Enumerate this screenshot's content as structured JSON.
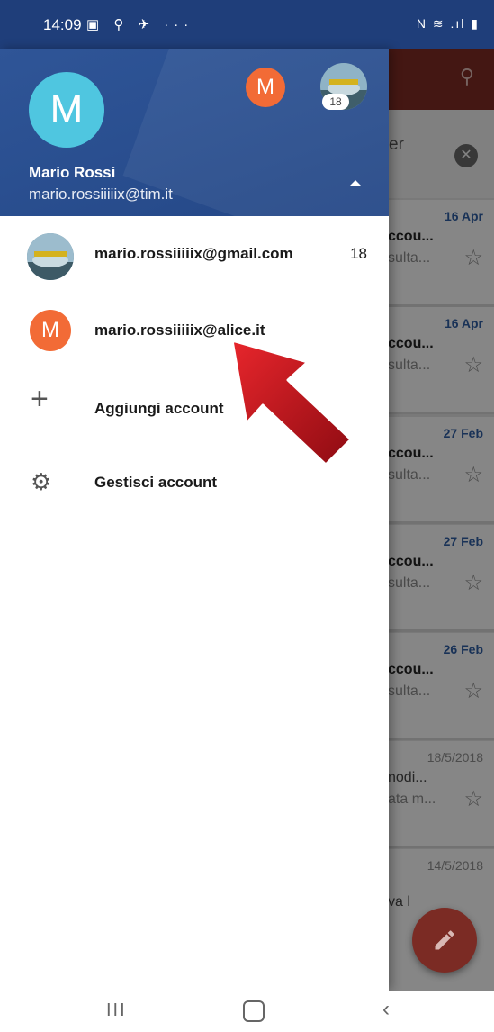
{
  "status_bar": {
    "time": "14:09",
    "left_icons": "▣ ⚲ ✈ ···",
    "right_icons": "N ≋ .ıl ▮"
  },
  "background_list": {
    "filter_text": "er",
    "rows": [
      {
        "date": "16 Apr",
        "subject": "ccou...",
        "preview": "sulta...",
        "unread": true
      },
      {
        "date": "16 Apr",
        "subject": "ccou...",
        "preview": "sulta...",
        "unread": true
      },
      {
        "date": "27 Feb",
        "subject": "ccou...",
        "preview": "sulta...",
        "unread": true
      },
      {
        "date": "27 Feb",
        "subject": "ccou...",
        "preview": "sulta...",
        "unread": true
      },
      {
        "date": "26 Feb",
        "subject": "ccou...",
        "preview": "sulta...",
        "unread": true
      },
      {
        "date": "18/5/2018",
        "subject": "nodi...",
        "preview": "ata m...",
        "unread": false
      },
      {
        "date": "14/5/2018",
        "subject": "va l",
        "preview": "",
        "unread": false
      }
    ]
  },
  "drawer": {
    "header": {
      "primary_avatar_letter": "M",
      "switch_avatar_letter": "M",
      "switch_badge_count": "18",
      "name": "Mario Rossi",
      "email": "mario.rossiiiiix@tim.it"
    },
    "items": [
      {
        "label": "mario.rossiiiiix@gmail.com",
        "count": "18"
      },
      {
        "label": "mario.rossiiiiix@alice.it",
        "avatar_letter": "M"
      },
      {
        "label": "Aggiungi account",
        "icon": "+"
      },
      {
        "label": "Gestisci account",
        "icon": "⚙"
      }
    ]
  },
  "colors": {
    "header_blue": "#2a4f90",
    "avatar_cyan": "#4fc6e0",
    "avatar_orange": "#f26b36",
    "app_red": "#7d2a23",
    "arrow_red": "#c0141c"
  },
  "nav_bar": {
    "recents": "III",
    "back": "‹"
  }
}
